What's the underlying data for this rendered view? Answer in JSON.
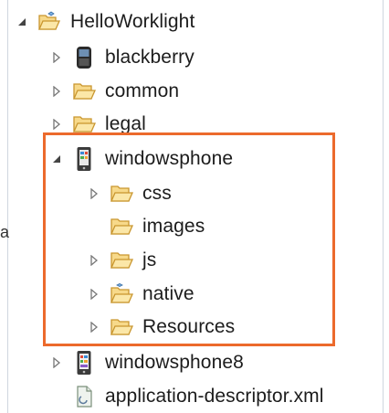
{
  "tree": {
    "items": [
      {
        "label": "HelloWorklight",
        "icon": "project-folder-icon",
        "expanded": true
      },
      {
        "label": "blackberry",
        "icon": "blackberry-device-icon",
        "expanded": false
      },
      {
        "label": "common",
        "icon": "folder-icon",
        "expanded": false
      },
      {
        "label": "legal",
        "icon": "folder-icon",
        "expanded": false
      },
      {
        "label": "windowsphone",
        "icon": "windows-phone-device-icon",
        "expanded": true
      },
      {
        "label": "css",
        "icon": "folder-icon",
        "expanded": false
      },
      {
        "label": "images",
        "icon": "folder-icon",
        "expanded": null
      },
      {
        "label": "js",
        "icon": "folder-icon",
        "expanded": false
      },
      {
        "label": "native",
        "icon": "native-folder-icon",
        "expanded": false
      },
      {
        "label": "Resources",
        "icon": "folder-icon",
        "expanded": false
      },
      {
        "label": "windowsphone8",
        "icon": "windows-phone8-device-icon",
        "expanded": false
      },
      {
        "label": "application-descriptor.xml",
        "icon": "xml-file-icon",
        "expanded": null
      }
    ]
  },
  "edge_glyph": "a",
  "colors": {
    "highlight": "#ec6a2c",
    "folder_fill": "#f7d98a",
    "folder_stroke": "#c9962f"
  }
}
